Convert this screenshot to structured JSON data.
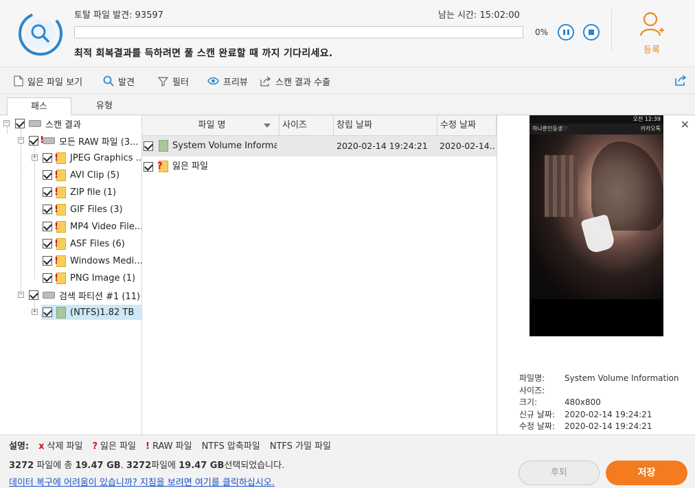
{
  "scan": {
    "found_label": "토탈 파일 발견:",
    "found_count": "93597",
    "time_label": "남는 시간:",
    "time_value": "15:02:00",
    "progress_value": 0,
    "progress_text": "0%",
    "hint": "최적 회복결과를 득하려면 풀 스캔 완료할 때 까지 기다리세요."
  },
  "header": {
    "register_label": "등록",
    "accent_color": "#f47b20",
    "primary_color": "#2a86cf"
  },
  "toolbar": {
    "items": [
      {
        "label": "잃은 파일 보기",
        "icon": "document-icon"
      },
      {
        "label": "발견",
        "icon": "search-icon"
      },
      {
        "label": "필터",
        "icon": "filter-icon"
      },
      {
        "label": "프리뷰",
        "icon": "eye-icon"
      },
      {
        "label": "스캔 결과 수출",
        "icon": "export-icon"
      }
    ],
    "export_icon": "share-icon"
  },
  "tabs": [
    {
      "label": "패스",
      "active": true
    },
    {
      "label": "유형",
      "active": false
    }
  ],
  "tree": {
    "root": "스캔 결과",
    "raw_group": "모든 RAW 파일 (3...",
    "raw_items": [
      "JPEG Graphics ...",
      "AVI Clip (5)",
      "ZIP file (1)",
      "GIF Files (3)",
      "MP4 Video File...",
      "ASF Files (6)",
      "Windows Medi...",
      "PNG Image (1)"
    ],
    "partition_group": "검색 파티션 #1 (11)",
    "partition_item": "(NTFS)1.82 TB"
  },
  "filelist": {
    "columns": [
      "파일 명",
      "사이즈",
      "창립 날짜",
      "수정 날짜"
    ],
    "rows": [
      {
        "name": "System Volume Informa...",
        "size": "",
        "created": "2020-02-14 19:24:21",
        "modified": "2020-02-14..."
      },
      {
        "name": "잃은 파일",
        "size": "",
        "created": "",
        "modified": ""
      }
    ]
  },
  "preview": {
    "status_bar": "오전 12:39",
    "app_title_left": "하나뿐인동생♡",
    "app_title_right": "카카오톡",
    "info": [
      {
        "key": "파일명:",
        "value": "System Volume Information"
      },
      {
        "key": "사이즈:",
        "value": ""
      },
      {
        "key": "크기:",
        "value": "480x800"
      },
      {
        "key": "신규 날짜:",
        "value": "2020-02-14 19:24:21"
      },
      {
        "key": "수정 날짜:",
        "value": "2020-02-14 19:24:21"
      }
    ]
  },
  "bottom": {
    "legend_title": "설명:",
    "legend": [
      {
        "mark": "x",
        "label": "삭제 파일"
      },
      {
        "mark": "?",
        "label": "잃은 파일"
      },
      {
        "mark": "!",
        "label": "RAW 파일"
      },
      {
        "mark": "",
        "label": "NTFS 압축파일"
      },
      {
        "mark": "",
        "label": "NTFS 가밀 파일"
      }
    ],
    "summary_count1": "3272",
    "summary_text1": " 파일에 총 ",
    "summary_size1": "19.47 GB",
    "summary_sep": ". ",
    "summary_count2": "3272",
    "summary_text2": "파일에 ",
    "summary_size2": "19.47 GB",
    "summary_text3": "선택되었습니다.",
    "help_link": "데이터 복구에 어려움이 있습니까? 지침을 보려면 여기를 클릭하십시오.",
    "back_label": "후퇴",
    "save_label": "저장"
  }
}
